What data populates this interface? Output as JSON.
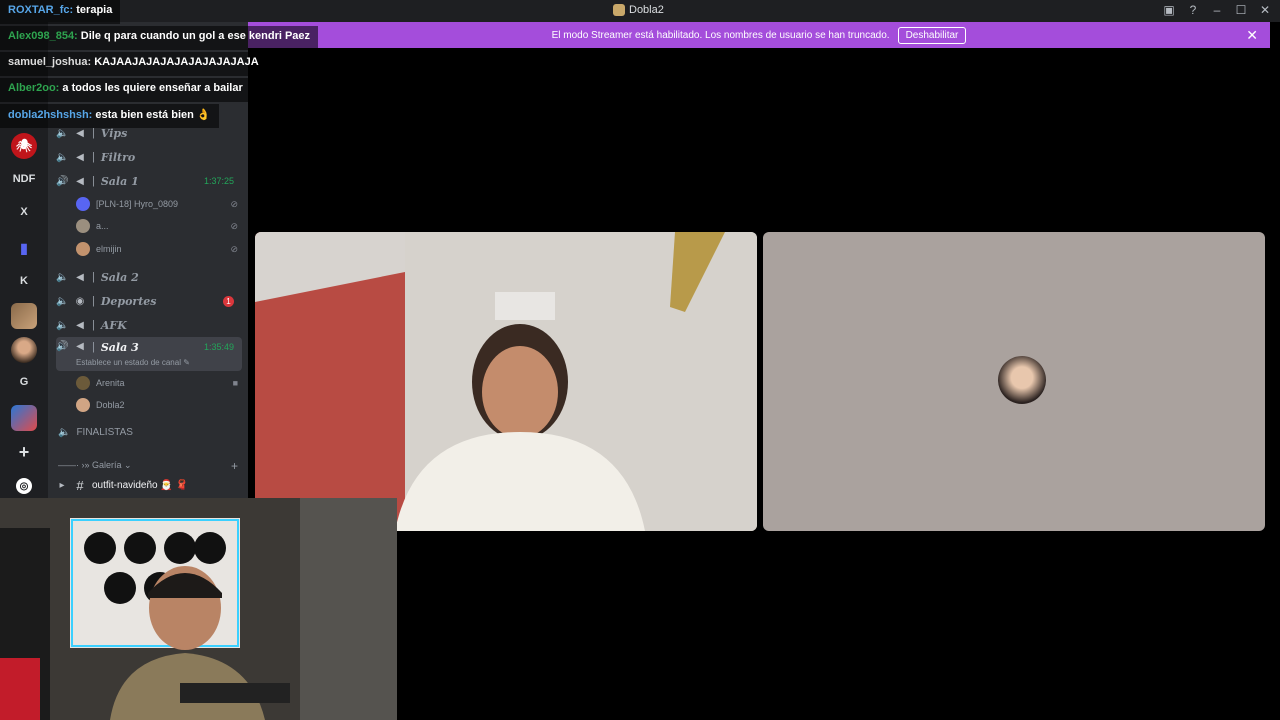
{
  "window": {
    "title": "Dobla2",
    "controls": [
      "screen-share-icon",
      "help-icon",
      "minimize-icon",
      "maximize-icon",
      "close-icon"
    ]
  },
  "banner": {
    "text": "El modo Streamer está habilitado. Los nombres de usuario se han truncado.",
    "button_label": "Deshabilitar",
    "close": "✕",
    "color": "#a44ddb"
  },
  "chat": [
    {
      "user": "ROXTAR_fc:",
      "message": "terapia",
      "user_color": "#57a6e8"
    },
    {
      "user": "Alex098_854:",
      "message": "Dile q para cuando un gol a ese kendri Paez",
      "user_color": "#2ea44f"
    },
    {
      "user": "samuel_joshua:",
      "message": "KAJAAJAJAJAJAJAJAJAJAJA",
      "user_color": "#dddddd"
    },
    {
      "user": "Alber2oo:",
      "message": "a todos les quiere enseñar a bailar",
      "user_color": "#2ea44f"
    },
    {
      "user": "dobla2hshshsh:",
      "message": "esta bien está bien 👌",
      "user_color": "#57a6e8"
    }
  ],
  "rail": {
    "items": [
      {
        "label": "",
        "icon": "spider-icon"
      },
      {
        "label": "NDF"
      },
      {
        "label": "X"
      },
      {
        "label": "",
        "icon": "folder-icon"
      },
      {
        "label": "K"
      },
      {
        "label": "",
        "icon": "server-avatar"
      },
      {
        "label": "",
        "icon": "server-avatar"
      },
      {
        "label": "G"
      },
      {
        "label": "",
        "icon": "server-avatar"
      },
      {
        "label": "+",
        "icon": "add-server-icon"
      },
      {
        "label": "",
        "icon": "explore-icon"
      }
    ]
  },
  "channels": {
    "voice": [
      {
        "name": "Vips"
      },
      {
        "name": "Filtro"
      },
      {
        "name": "Sala 1",
        "timer": "1:37:25",
        "users": [
          {
            "name": "[PLN-18] Hyro_0809",
            "muted": true
          },
          {
            "name": "a...",
            "muted": true
          },
          {
            "name": "elmijin",
            "muted": true
          }
        ]
      },
      {
        "name": "Sala 2"
      },
      {
        "name": "Deportes",
        "badge": "1"
      },
      {
        "name": "AFK"
      },
      {
        "name": "Sala 3",
        "timer": "1:35:49",
        "status": "Establece un estado de canal ✎",
        "users": [
          {
            "name": "Arenita",
            "video": true
          },
          {
            "name": "Dobla2"
          }
        ]
      }
    ],
    "finalistas": "FINALISTAS",
    "category": "——· ›» Galería ⌄",
    "text_channel": "outfit-navideño 🎅 🧣"
  },
  "video": {
    "left_tile_label": "",
    "right_tile_label": ""
  }
}
